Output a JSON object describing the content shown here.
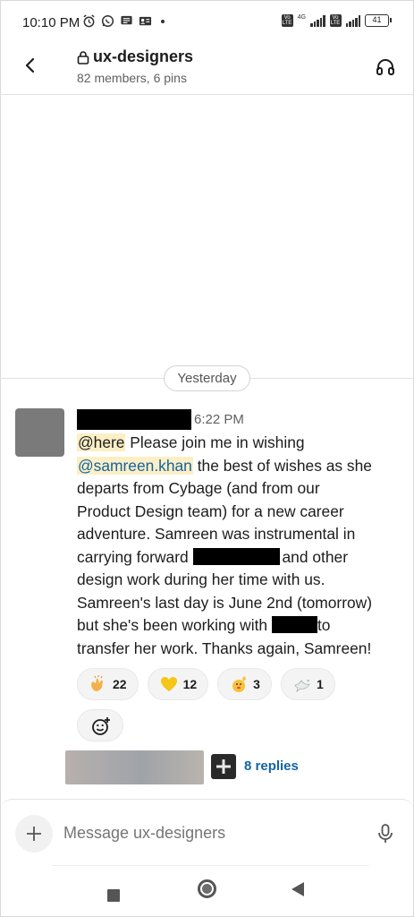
{
  "status_bar": {
    "time": "10:10 PM",
    "battery": "41",
    "network": "4G",
    "icons": [
      "alarm-icon",
      "whatsapp-icon",
      "message-icon",
      "contacts-icon"
    ]
  },
  "header": {
    "channel_name": "ux-designers",
    "subtitle": "82 members, 6 pins",
    "icons": [
      "back-arrow-icon",
      "lock-icon",
      "headphones-icon"
    ]
  },
  "divider": {
    "label": "Yesterday"
  },
  "message": {
    "time": "6:22 PM",
    "mention_here": "@here",
    "line1_rest": " Please join me in wishing",
    "mention_user": "@samreen.khan",
    "line2_rest": " the best of wishes as she",
    "line3": "departs from Cybage (and from our",
    "line4": "Product Design team) for a new career",
    "line5": "adventure. Samreen was instrumental in",
    "line6_start": "carrying forward ",
    "line6_end": "and other",
    "line7": "design work during her time with us.",
    "line8": "Samreen's last day is June 2nd (tomorrow)",
    "line9_start": "but she's been working with ",
    "line9_end": "to",
    "line10": "transfer her work. Thanks again, Samreen!"
  },
  "reactions": [
    {
      "emoji": "clapping-hands-icon",
      "count": "22"
    },
    {
      "emoji": "yellow-heart-icon",
      "count": "12"
    },
    {
      "emoji": "waving-hand-icon",
      "count": "3"
    },
    {
      "emoji": "dove-icon",
      "count": "1"
    }
  ],
  "thread": {
    "replies_label": "8 replies"
  },
  "composer": {
    "placeholder": "Message ux-designers"
  },
  "colors": {
    "link": "#1264a3",
    "mention_bg": "#fcefc5",
    "text": "#1d1c1d",
    "muted": "#616061"
  }
}
